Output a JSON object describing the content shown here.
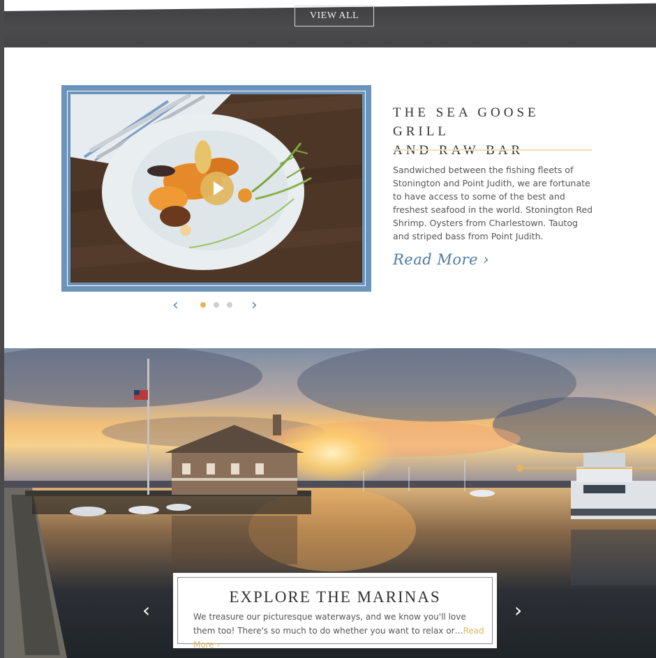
{
  "top": {
    "view_all": "VIEW ALL"
  },
  "feature": {
    "title_line1": "THE SEA GOOSE GRILL",
    "title_line2": "AND RAW BAR",
    "description": "Sandwiched between the fishing fleets of Stonington and Point Judith, we are fortunate to have access to some of the best and freshest seafood in the world. Stonington Red Shrimp. Oysters from Charlestown. Tautog and striped bass from Point Judith.",
    "read_more": "Read More ›",
    "carousel": {
      "prev": "‹",
      "next": "›",
      "dots": 3,
      "active_dot": 1
    }
  },
  "hero": {
    "title": "EXPLORE THE MARINAS",
    "text": "We treasure our picturesque waterways, and we know you'll love them too! There's so much to do whether you want to relax or…",
    "read_more": "Read More ›",
    "prev": "‹",
    "next": "›"
  },
  "colors": {
    "accent_blue": "#6c93ba",
    "accent_gold": "#e2b45e"
  }
}
